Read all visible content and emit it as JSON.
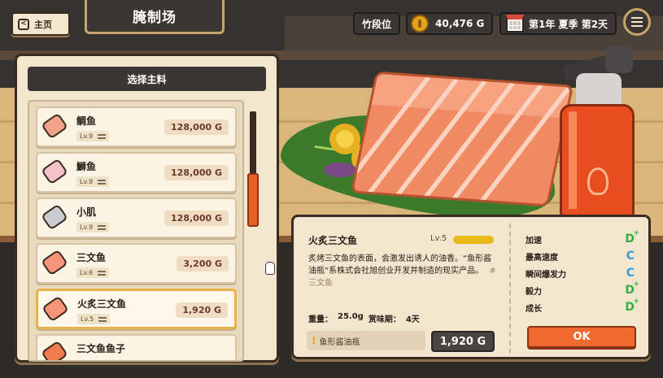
{
  "header": {
    "home_label": "主页",
    "title": "腌制场",
    "rank_label": "竹段位",
    "money": "40,476 G",
    "date": "第1年 夏季 第2天"
  },
  "list": {
    "header": "选择主料",
    "items": [
      {
        "name": "鲷鱼",
        "level": "Lv.9",
        "price": "128,000 G",
        "icon": "pink-fish-fillet-icon",
        "color": "#f0a38a"
      },
      {
        "name": "鰤鱼",
        "level": "Lv.9",
        "price": "128,000 G",
        "icon": "white-pink-fish-fillet-icon",
        "color": "#f6c2c9"
      },
      {
        "name": "小肌",
        "level": "Lv.9",
        "price": "128,000 G",
        "icon": "silver-fish-fillet-icon",
        "color": "#c9ccd2"
      },
      {
        "name": "三文鱼",
        "level": "Lv.6",
        "price": "3,200 G",
        "icon": "salmon-fillet-icon",
        "color": "#f4957a"
      },
      {
        "name": "火炙三文鱼",
        "level": "Lv.5",
        "price": "1,920 G",
        "icon": "seared-salmon-fillet-icon",
        "color": "#f4957a",
        "selected": true
      },
      {
        "name": "三文鱼鱼子",
        "level": "",
        "price": "",
        "icon": "salmon-roe-icon",
        "color": "#f27a4f"
      }
    ]
  },
  "detail": {
    "name": "火炙三文鱼",
    "level": "Lv.5",
    "level_progress": 1.0,
    "description": "炙烤三文鱼的表面，会激发出诱人的油香。“鱼形酱油瓶”系株式会社旭创业开发并制造的现实产品。",
    "tag": "#三文鱼",
    "weight_label": "重量：",
    "weight": "25.0g",
    "shelf_label": "赏味期：",
    "shelf": "4天",
    "source": "鱼形酱油瓶",
    "price": "1,920 G",
    "stats": [
      {
        "label": "加速",
        "grade": "D",
        "plus": "+"
      },
      {
        "label": "最高速度",
        "grade": "C",
        "plus": ""
      },
      {
        "label": "瞬间爆发力",
        "grade": "C",
        "plus": ""
      },
      {
        "label": "毅力",
        "grade": "D",
        "plus": "+"
      },
      {
        "label": "成长",
        "grade": "D",
        "plus": "+"
      }
    ],
    "ok_label": "OK"
  },
  "colors": {
    "accent": "#ef6a2e",
    "panel": "#f3e6cf",
    "dark": "#3b3634",
    "gold": "#e8b918"
  }
}
